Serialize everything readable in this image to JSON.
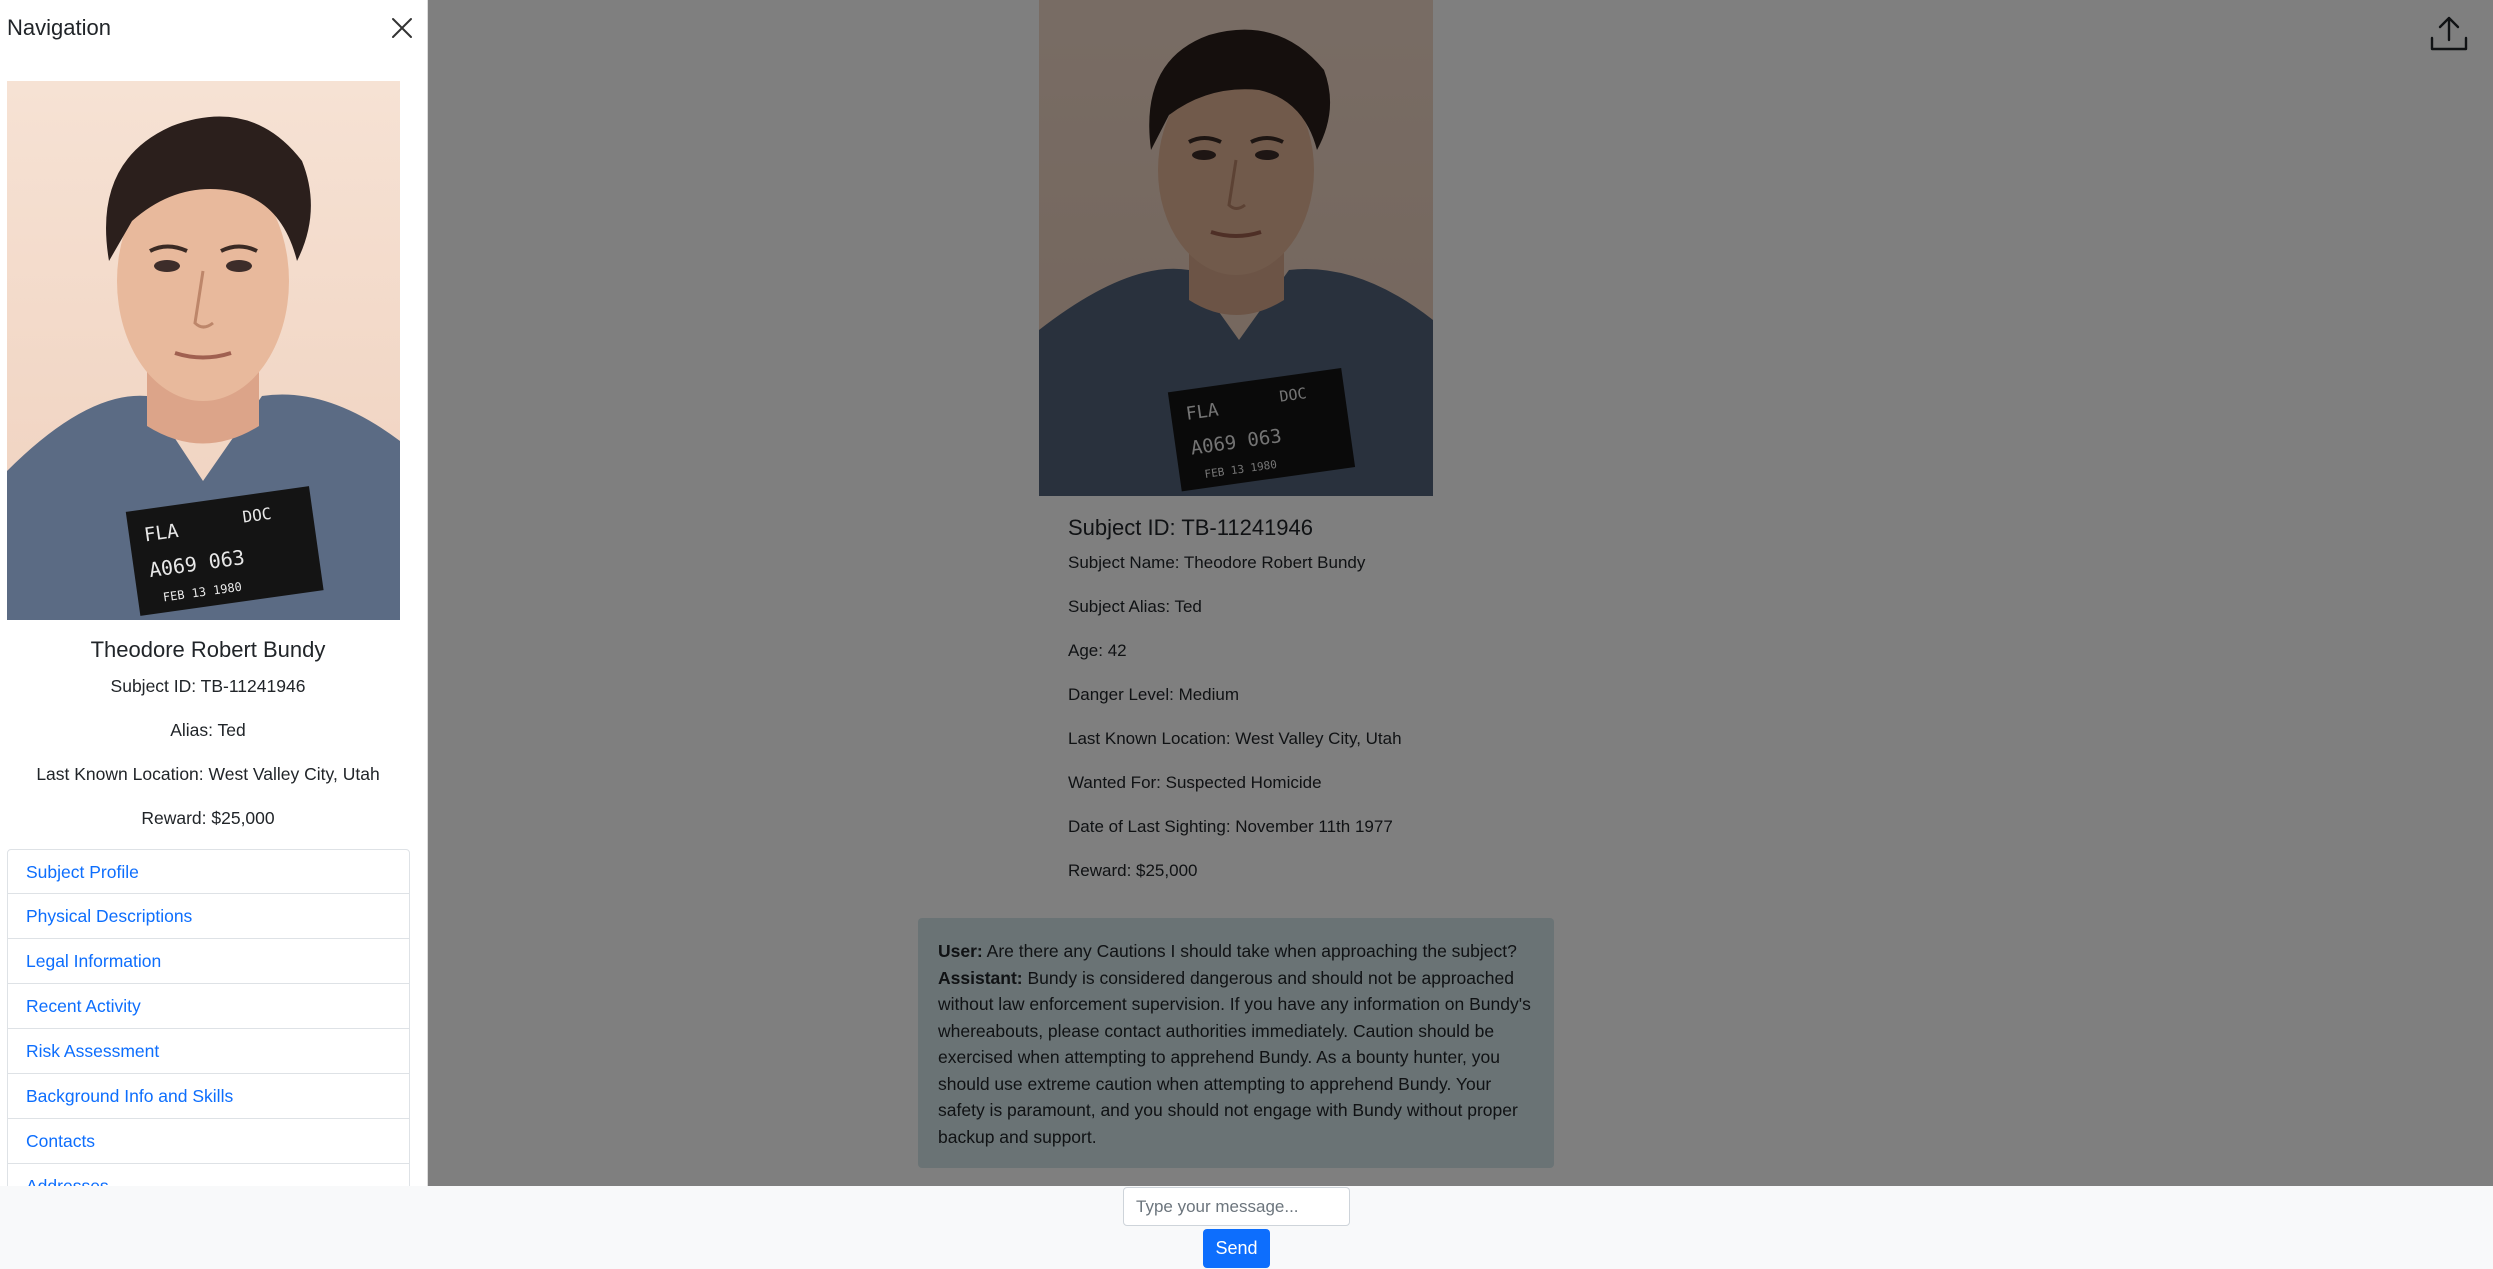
{
  "sidebar": {
    "title": "Navigation",
    "name": "Theodore Robert Bundy",
    "subject_id": "Subject ID: TB-11241946",
    "alias": "Alias: Ted",
    "location": "Last Known Location: West Valley City, Utah",
    "reward": "Reward: $25,000",
    "nav_items": [
      {
        "label": "Subject Profile"
      },
      {
        "label": "Physical Descriptions"
      },
      {
        "label": "Legal Information"
      },
      {
        "label": "Recent Activity"
      },
      {
        "label": "Risk Assessment"
      },
      {
        "label": "Background Info and Skills"
      },
      {
        "label": "Contacts"
      },
      {
        "label": "Addresses"
      }
    ]
  },
  "main": {
    "title": "Subject ID: TB-11241946",
    "subject_name": "Subject Name: Theodore Robert Bundy",
    "subject_alias": "Subject Alias: Ted",
    "age": "Age: 42",
    "danger_level": "Danger Level: Medium",
    "last_location": "Last Known Location: West Valley City, Utah",
    "wanted_for": "Wanted For: Suspected Homicide",
    "last_sighting": "Date of Last Sighting: November 11th 1977",
    "reward": "Reward: $25,000"
  },
  "chat": {
    "user_label": "User:",
    "user_message": "Are there any Cautions I should take when approaching the subject?",
    "assistant_label": "Assistant:",
    "assistant_message": "Bundy is considered dangerous and should not be approached without law enforcement supervision. If you have any information on Bundy's whereabouts, please contact authorities immediately. Caution should be exercised when attempting to apprehend Bundy. As a bounty hunter, you should use extreme caution when attempting to apprehend Bundy. Your safety is paramount, and you should not engage with Bundy without proper backup and support."
  },
  "input": {
    "placeholder": "Type your message...",
    "send_label": "Send"
  },
  "placard": {
    "line1_left": "FLA",
    "line1_right": "DOC",
    "line2": "A069 063",
    "line3": "FEB 13 1980"
  },
  "icons": {
    "close": "close-icon",
    "upload": "upload-icon"
  },
  "colors": {
    "link": "#0d6efd",
    "button": "#0d6efd",
    "chat_bg": "#d4e6ea"
  }
}
